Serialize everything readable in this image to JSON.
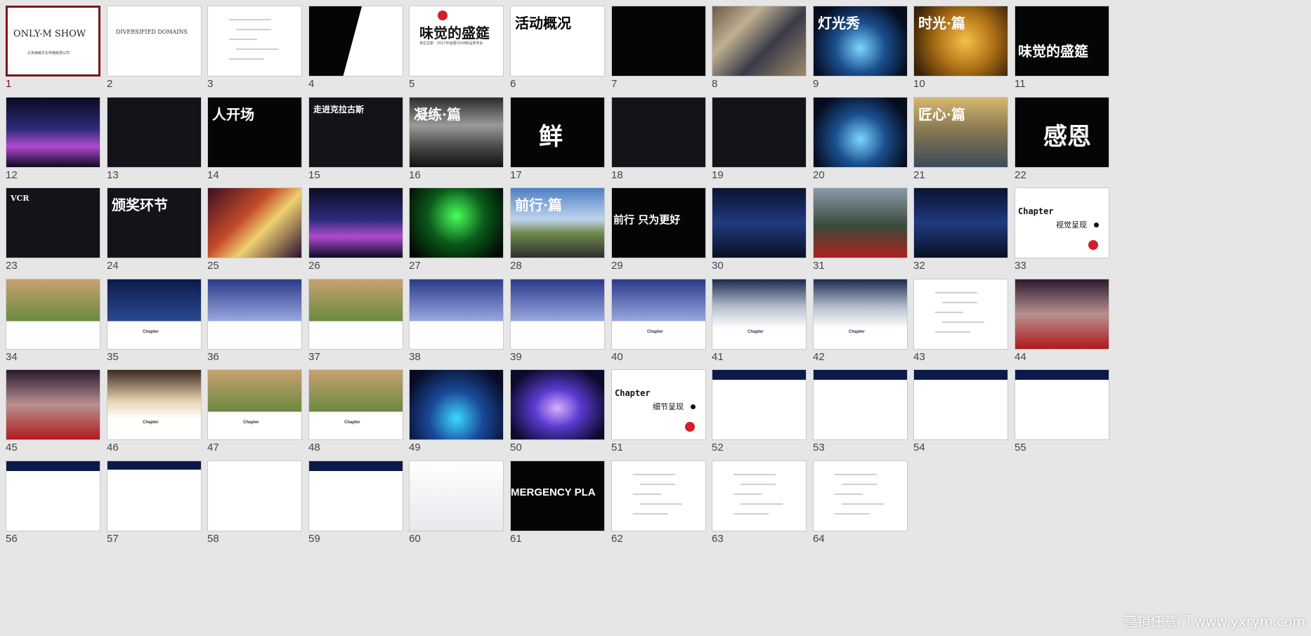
{
  "selected": "1",
  "watermark": "营销任意门 www.yxrym.com",
  "slides": [
    {
      "num": "1",
      "style": "t-white",
      "title": "ONLY-M SHOW",
      "sub": "北京萌萌文化传播有限公司"
    },
    {
      "num": "2",
      "style": "t-white",
      "title": "DIVERSIFIED DOMAINS"
    },
    {
      "num": "3",
      "style": "t-white"
    },
    {
      "num": "4",
      "style": "t-black"
    },
    {
      "num": "5",
      "style": "t-white",
      "title": "味觉的盛筵",
      "sub": "克拉古斯 · 2017年会暨2018新品发布会"
    },
    {
      "num": "6",
      "style": "t-white",
      "title": "活动概况"
    },
    {
      "num": "7",
      "style": "t-black"
    },
    {
      "num": "8",
      "style": "t-photo"
    },
    {
      "num": "9",
      "style": "t-cyan",
      "title": "灯光秀"
    },
    {
      "num": "10",
      "style": "t-gold",
      "title": "时光·篇"
    },
    {
      "num": "11",
      "style": "t-black",
      "title": "味觉的盛筵"
    },
    {
      "num": "12",
      "style": "t-stage"
    },
    {
      "num": "13",
      "style": "t-dark"
    },
    {
      "num": "14",
      "style": "t-black",
      "title": "人开场"
    },
    {
      "num": "15",
      "style": "t-dark",
      "title": "走进克拉古斯"
    },
    {
      "num": "16",
      "style": "t-mountain",
      "title": "凝练·篇"
    },
    {
      "num": "17",
      "style": "t-black",
      "title": "鲜"
    },
    {
      "num": "18",
      "style": "t-dark"
    },
    {
      "num": "19",
      "style": "t-dark"
    },
    {
      "num": "20",
      "style": "t-cyan"
    },
    {
      "num": "21",
      "style": "t-city",
      "title": "匠心·篇"
    },
    {
      "num": "22",
      "style": "t-black",
      "title": "感恩"
    },
    {
      "num": "23",
      "style": "t-dark",
      "title": "VCR"
    },
    {
      "num": "24",
      "style": "t-dark",
      "title": "颁奖环节"
    },
    {
      "num": "25",
      "style": "t-party"
    },
    {
      "num": "26",
      "style": "t-stage"
    },
    {
      "num": "27",
      "style": "t-green"
    },
    {
      "num": "28",
      "style": "t-sky",
      "title": "前行·篇"
    },
    {
      "num": "29",
      "style": "t-black",
      "title": "前行 只为更好"
    },
    {
      "num": "30",
      "style": "t-night"
    },
    {
      "num": "31",
      "style": "t-crowd"
    },
    {
      "num": "32",
      "style": "t-night"
    },
    {
      "num": "33",
      "style": "t-white",
      "title": "Chapter",
      "sub": "视觉呈现"
    },
    {
      "num": "34",
      "style": "t-photowhite"
    },
    {
      "num": "35",
      "style": "t-navywhite",
      "title": "Chapter"
    },
    {
      "num": "36",
      "style": "t-bluewhite"
    },
    {
      "num": "37",
      "style": "t-photowhite"
    },
    {
      "num": "38",
      "style": "t-bluewhite"
    },
    {
      "num": "39",
      "style": "t-bluewhite"
    },
    {
      "num": "40",
      "style": "t-bluewhite",
      "title": "Chapter"
    },
    {
      "num": "41",
      "style": "t-cloud",
      "title": "Chapter"
    },
    {
      "num": "42",
      "style": "t-cloud",
      "title": "Chapter"
    },
    {
      "num": "43",
      "style": "t-white"
    },
    {
      "num": "44",
      "style": "t-red"
    },
    {
      "num": "45",
      "style": "t-red"
    },
    {
      "num": "46",
      "style": "t-banquet",
      "title": "Chapter"
    },
    {
      "num": "47",
      "style": "t-photowhite",
      "title": "Chapter"
    },
    {
      "num": "48",
      "style": "t-photowhite",
      "title": "Chapter"
    },
    {
      "num": "49",
      "style": "t-pool"
    },
    {
      "num": "50",
      "style": "t-purple"
    },
    {
      "num": "51",
      "style": "t-white",
      "title": "Chapter",
      "sub": "细节呈现"
    },
    {
      "num": "52",
      "style": "t-navyband"
    },
    {
      "num": "53",
      "style": "t-navyband"
    },
    {
      "num": "54",
      "style": "t-navyband"
    },
    {
      "num": "55",
      "style": "t-navyband"
    },
    {
      "num": "56",
      "style": "t-navyband"
    },
    {
      "num": "57",
      "style": "t-phone"
    },
    {
      "num": "58",
      "style": "t-card"
    },
    {
      "num": "59",
      "style": "t-navyband"
    },
    {
      "num": "60",
      "style": "t-box"
    },
    {
      "num": "61",
      "style": "t-black",
      "title": "MERGENCY PLA"
    },
    {
      "num": "62",
      "style": "t-white"
    },
    {
      "num": "63",
      "style": "t-white"
    },
    {
      "num": "64",
      "style": "t-white"
    }
  ]
}
